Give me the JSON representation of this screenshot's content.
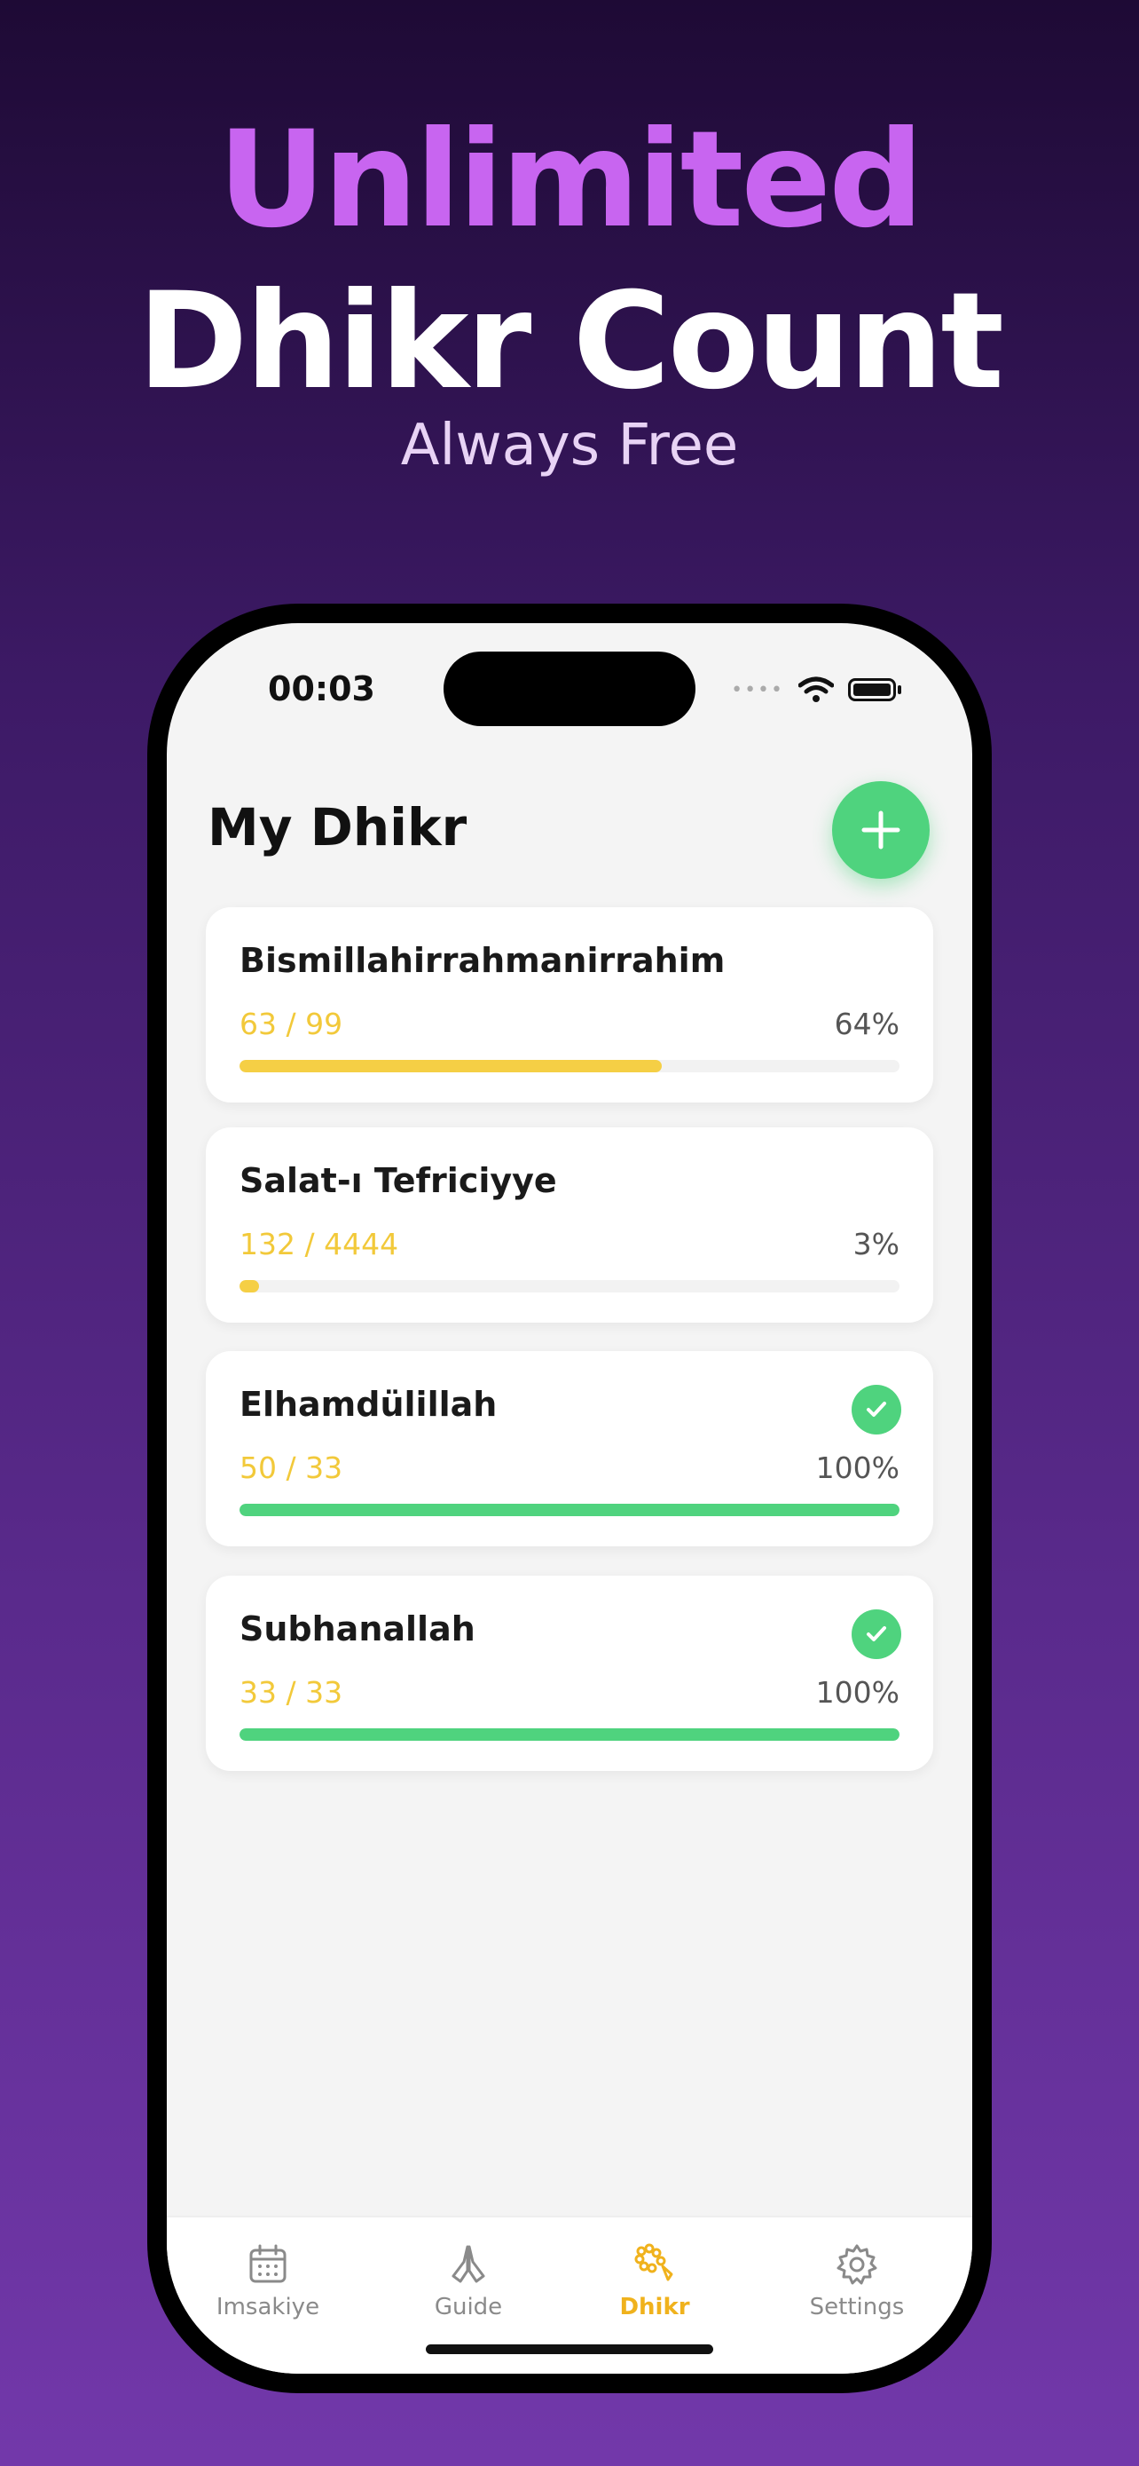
{
  "promo": {
    "line1": "Unlimited",
    "line2": "Dhikr Count",
    "line3": "Always Free"
  },
  "status_bar": {
    "time": "00:03"
  },
  "page": {
    "title": "My Dhikr",
    "add_icon": "plus-icon"
  },
  "dhikr_items": [
    {
      "name": "Bismillahirrahmanirrahim",
      "count": "63 / 99",
      "percent": "64%",
      "progress": 0.64,
      "completed": false
    },
    {
      "name": "Salat-ı Tefriciyye",
      "count": "132 / 4444",
      "percent": "3%",
      "progress": 0.03,
      "completed": false
    },
    {
      "name": "Elhamdülillah",
      "count": "50 / 33",
      "percent": "100%",
      "progress": 1.0,
      "completed": true
    },
    {
      "name": "Subhanallah",
      "count": "33 / 33",
      "percent": "100%",
      "progress": 1.0,
      "completed": true
    }
  ],
  "tab_bar": {
    "tabs": [
      {
        "label": "Imsakiye",
        "icon": "calendar-icon",
        "active": false
      },
      {
        "label": "Guide",
        "icon": "praying-hands-icon",
        "active": false
      },
      {
        "label": "Dhikr",
        "icon": "prayer-beads-icon",
        "active": true
      },
      {
        "label": "Settings",
        "icon": "gear-icon",
        "active": false
      }
    ]
  },
  "colors": {
    "accent_green": "#4fd37e",
    "progress_yellow": "#f5cf45",
    "count_yellow": "#f2c93a",
    "active_tab": "#f0b21d",
    "headline_purple": "#c865f0"
  }
}
